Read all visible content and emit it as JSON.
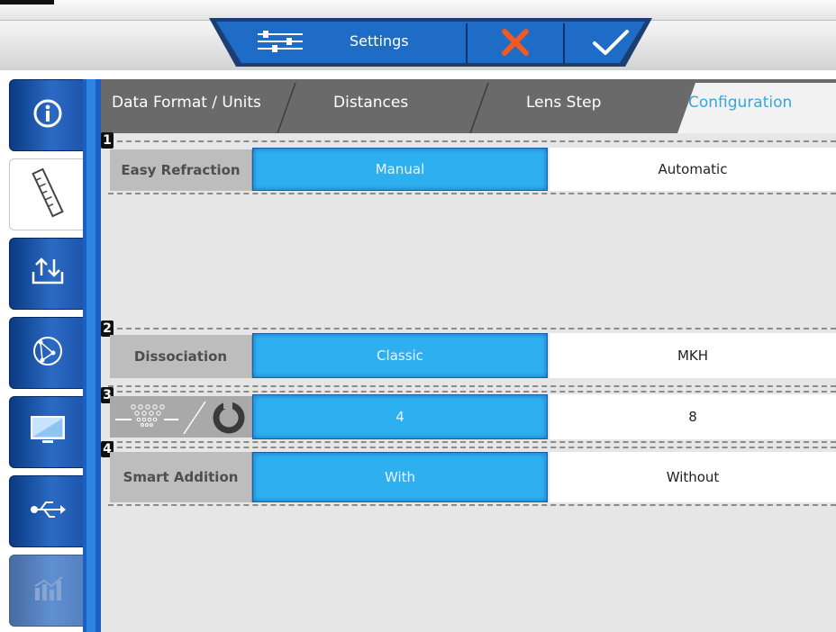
{
  "toolbar": {
    "settings_label": "Settings",
    "settings_icon": "sliders-icon",
    "cancel_icon": "close-icon",
    "confirm_icon": "check-icon",
    "colors": {
      "bar": "#1f6cc6",
      "cancel": "#f05a22",
      "confirm": "#ffffff"
    }
  },
  "sidebar": {
    "items": [
      {
        "icon": "info-icon",
        "active": false
      },
      {
        "icon": "ruler-icon",
        "active": true
      },
      {
        "icon": "import-export-icon",
        "active": false
      },
      {
        "icon": "network-icon",
        "active": false
      },
      {
        "icon": "monitor-icon",
        "active": false
      },
      {
        "icon": "usb-icon",
        "active": false
      },
      {
        "icon": "statistics-icon",
        "active": false
      }
    ]
  },
  "tabs": [
    {
      "label": "Data Format / Units",
      "active": false
    },
    {
      "label": "Distances",
      "active": false
    },
    {
      "label": "Lens Step",
      "active": false
    },
    {
      "label": "Configuration",
      "active": true
    }
  ],
  "sections": [
    {
      "marker": "1",
      "label": "Easy Refraction",
      "options": [
        {
          "label": "Manual",
          "selected": true
        },
        {
          "label": "Automatic",
          "selected": false
        }
      ]
    },
    {
      "marker": "2",
      "label": "Dissociation",
      "options": [
        {
          "label": "Classic",
          "selected": true
        },
        {
          "label": "MKH",
          "selected": false
        }
      ]
    },
    {
      "marker": "3",
      "label_icon": "dot-chart-vs-ring-icon",
      "options": [
        {
          "label": "4",
          "selected": true
        },
        {
          "label": "8",
          "selected": false
        }
      ]
    },
    {
      "marker": "4",
      "label": "Smart Addition",
      "options": [
        {
          "label": "With",
          "selected": true
        },
        {
          "label": "Without",
          "selected": false
        }
      ]
    }
  ],
  "colors": {
    "selected": "#2eaff0",
    "active_tab": "#3aa5d8",
    "tab_bar": "#6a6a6a",
    "sidebar": "#2b6ac4"
  }
}
